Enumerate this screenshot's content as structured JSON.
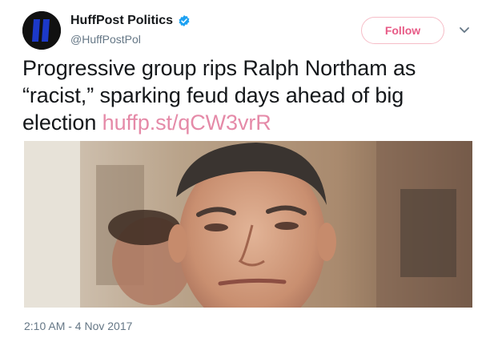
{
  "account": {
    "display_name": "HuffPost Politics",
    "handle": "@HuffPostPol",
    "verified_icon": "verified-badge-icon",
    "avatar_icon": "huffpost-logo"
  },
  "actions": {
    "follow_label": "Follow",
    "more_icon": "chevron-down-icon"
  },
  "tweet": {
    "text": "Progressive group rips Ralph Northam as “racist,” sparking feud days ahead of big election ",
    "link": "huffp.st/qCW3vrR",
    "image_description_icon": "news-photo",
    "timestamp": "2:10 AM - 4 Nov 2017"
  },
  "colors": {
    "follow_accent": "#e0245e",
    "verified": "#1da1f2",
    "link": "#e58aa8",
    "muted": "#657786"
  }
}
